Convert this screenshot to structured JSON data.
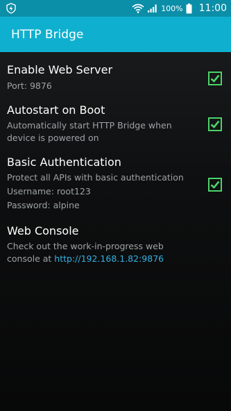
{
  "status_bar": {
    "battery_percent": "100%",
    "time": "11:00",
    "icons": [
      "app-notification-icon",
      "wifi-icon",
      "signal-icon",
      "battery-icon"
    ]
  },
  "action_bar": {
    "title": "HTTP Bridge",
    "color": "#0fb0cf"
  },
  "preferences": [
    {
      "title": "Enable Web Server",
      "summary": [
        "Port: 9876"
      ],
      "checked": true
    },
    {
      "title": "Autostart on Boot",
      "summary": [
        "Automatically start HTTP Bridge when device is powered on"
      ],
      "checked": true
    },
    {
      "title": "Basic Authentication",
      "summary": [
        "Protect all APIs with basic authentication",
        "Username: root123",
        "Password: alpine"
      ],
      "checked": true
    },
    {
      "title": "Web Console",
      "summary_prefix": "Check out the work-in-progress web console at ",
      "link": "http://192.168.1.82:9876"
    }
  ],
  "colors": {
    "checkbox": "#4cd36a",
    "link": "#34b2e4",
    "status_bar": "#0b8ea8"
  }
}
